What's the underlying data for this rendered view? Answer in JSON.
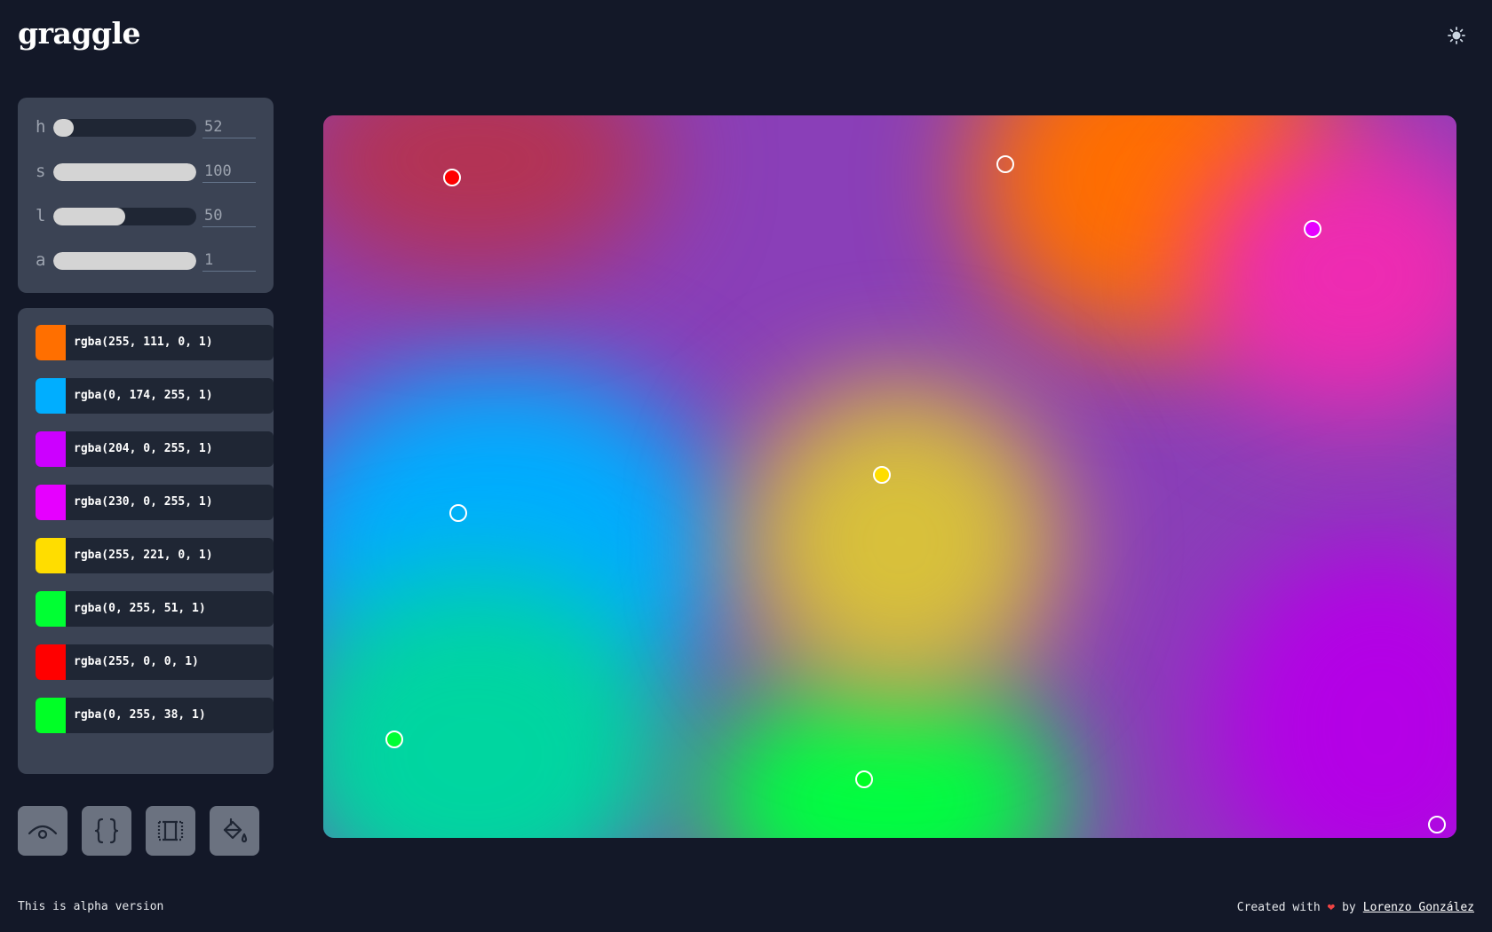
{
  "app": {
    "title": "graggle",
    "theme_icon": "sun-icon"
  },
  "hsla": {
    "h": {
      "label": "h",
      "value": "52",
      "fill": 0.14
    },
    "s": {
      "label": "s",
      "value": "100",
      "fill": 1.0
    },
    "l": {
      "label": "l",
      "value": "50",
      "fill": 0.5
    },
    "a": {
      "label": "a",
      "value": "1",
      "fill": 1.0
    }
  },
  "colors": [
    {
      "text": "rgba(255, 111, 0, 1)",
      "hex": "#ff6f00"
    },
    {
      "text": "rgba(0, 174, 255, 1)",
      "hex": "#00aeff"
    },
    {
      "text": "rgba(204, 0, 255, 1)",
      "hex": "#cc00ff"
    },
    {
      "text": "rgba(230, 0, 255, 1)",
      "hex": "#e600ff"
    },
    {
      "text": "rgba(255, 221, 0, 1)",
      "hex": "#ffdd00"
    },
    {
      "text": "rgba(0, 255, 51, 1)",
      "hex": "#00ff33"
    },
    {
      "text": "rgba(255, 0, 0, 1)",
      "hex": "#ff0000"
    },
    {
      "text": "rgba(0, 255, 38, 1)",
      "hex": "#00ff26"
    }
  ],
  "toolbar": {
    "preview_icon": "eye-icon",
    "code_icon": "braces-icon",
    "frame_icon": "frame-icon",
    "fill_icon": "paint-bucket-icon"
  },
  "footer": {
    "alpha_note": "This is alpha version",
    "created_with": "Created with",
    "by": "by",
    "author": "Lorenzo González"
  }
}
